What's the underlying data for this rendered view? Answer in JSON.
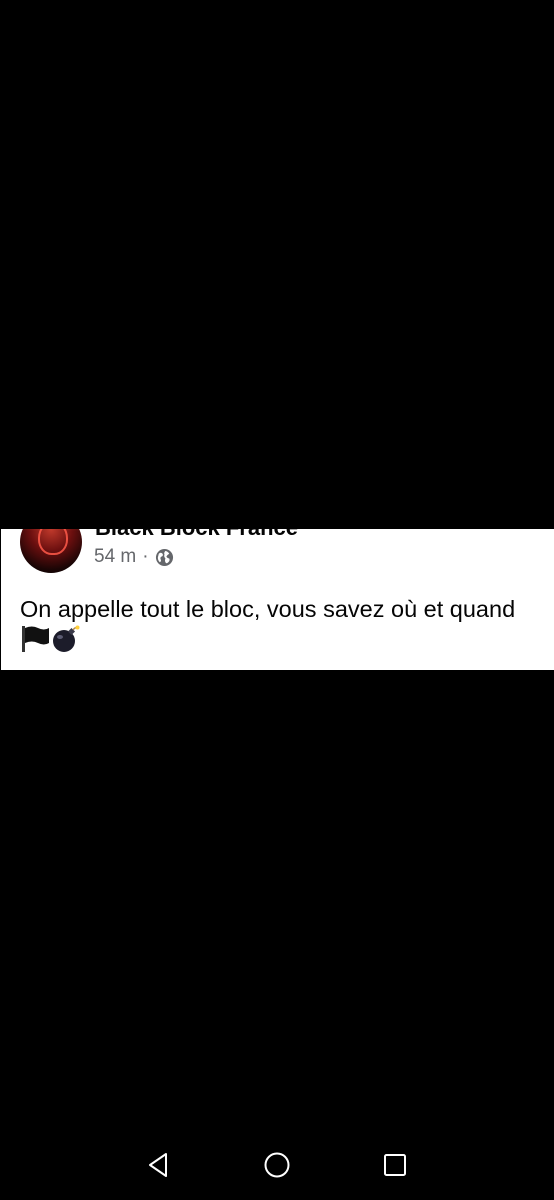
{
  "post": {
    "author": "Black Block France",
    "time": "54 m",
    "separator": "·",
    "audience_icon": "globe-icon",
    "text": "On appelle tout le bloc, vous savez où et quand",
    "emojis": [
      "black-flag-icon",
      "bomb-icon"
    ]
  },
  "nav_bar": {
    "buttons": [
      "back-icon",
      "home-icon",
      "recents-icon"
    ]
  },
  "colors": {
    "background": "#000000",
    "card": "#ffffff",
    "text": "#050505",
    "meta": "#65676b"
  }
}
